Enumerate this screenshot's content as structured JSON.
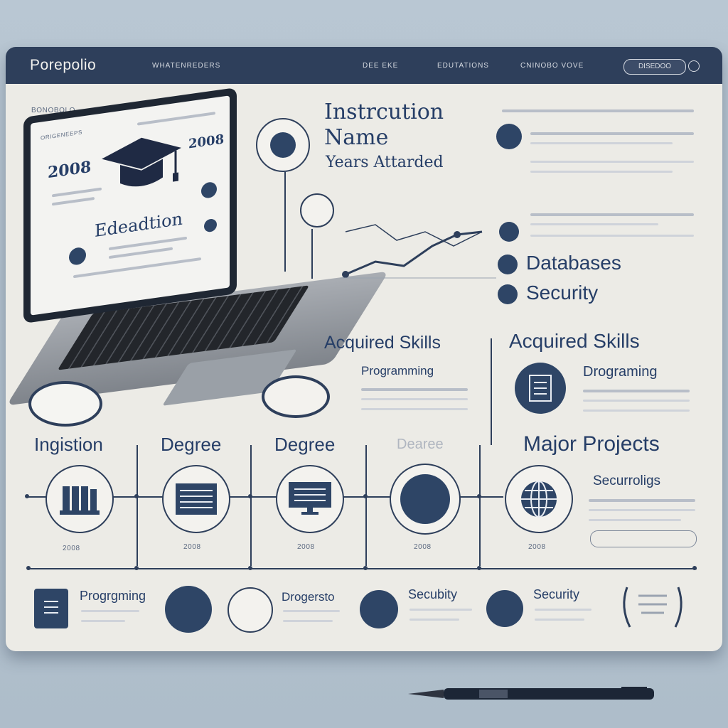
{
  "header": {
    "brand": "Porepolio",
    "nav": [
      "WHATENREDERS",
      "DEE EKE",
      "EDUTATIONS",
      "CNINOBO VOVE"
    ],
    "button": "DISEDOO"
  },
  "left_label": "BONOBOLO",
  "laptop": {
    "tiny_top": "ORIGENEEPS",
    "year_left": "2008",
    "year_right": "2008",
    "screen_title": "Edeadtion"
  },
  "institution": {
    "title_line1": "Instrcution",
    "title_line2": "Name",
    "subtitle": "Years Attarded"
  },
  "right_list": {
    "skill1": "Databases",
    "skill2": "Security"
  },
  "acquired": {
    "left_heading": "Acquired Skills",
    "left_sub": "Programming",
    "right_heading": "Acquired Skills",
    "right_sub": "Drograming"
  },
  "timeline": {
    "labels": [
      "Ingistion",
      "Degree",
      "Degree",
      "Dearee"
    ],
    "captions": [
      "2008",
      "2008",
      "2008",
      "2008",
      "2008"
    ],
    "major_heading": "Major Projects",
    "major_sub": "Securroligs"
  },
  "bottom": {
    "item1": "Progrgming",
    "item2": "Drogersto",
    "item3": "Secubity",
    "item4": "Security"
  },
  "icons": [
    "graduation-cap-icon",
    "books-icon",
    "document-icon",
    "monitor-icon",
    "globe-icon",
    "lock-icon",
    "laurel-wreath-icon",
    "pen-icon"
  ],
  "colors": {
    "navy": "#2e3f5b",
    "board": "#ecebe6",
    "background": "#b9c7d3",
    "accent_text": "#263e67"
  }
}
